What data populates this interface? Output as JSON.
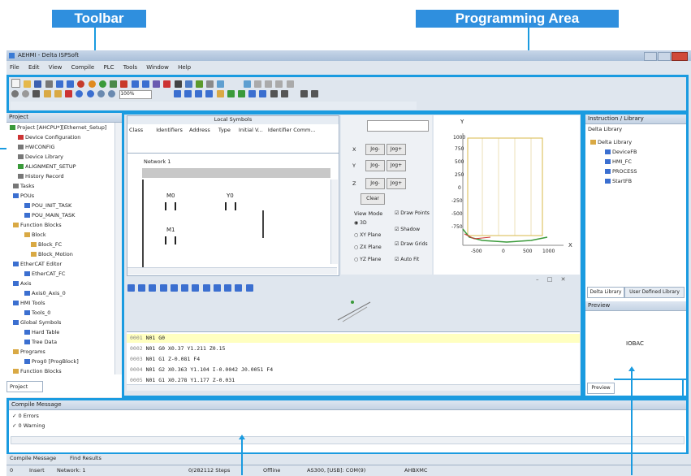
{
  "callouts": {
    "toolbar": "Toolbar",
    "programming_area": "Programming Area"
  },
  "window": {
    "title": "AEHMI - Delta ISPSoft",
    "menu": [
      "File",
      "Edit",
      "View",
      "Compile",
      "PLC",
      "Tools",
      "Window",
      "Help"
    ],
    "zoom": "100%"
  },
  "project_pane": {
    "title": "Project",
    "tab": "Project",
    "items": [
      "Project [AHCPU*][Ethernet_Setup]",
      "Device Configuration",
      "HWCONFIG",
      "Device Library",
      "ALIGNMENT_SETUP",
      "History Record",
      "Tasks",
      "POUs",
      "POU_INIT_TASK",
      "POU_MAIN_TASK",
      "Function Blocks",
      "Block",
      "Block_FC",
      "Block_Motion",
      "EtherCAT Editor",
      "EtherCAT_FC",
      "Axis",
      "Axis0_Axis_0",
      "HMI Tools",
      "Tools_0",
      "Global Symbols",
      "Hard Table",
      "Tree Data",
      "Programs",
      "Prog0 [ProgBlock]",
      "Function Blocks"
    ]
  },
  "local_symbols": {
    "title": "Local Symbols",
    "columns": [
      "Class",
      "Identifiers",
      "Address",
      "Type",
      "Initial V...",
      "Identifier Comm..."
    ]
  },
  "ladder": {
    "network": "Network 1",
    "contact1": "M0",
    "contact2": "M1",
    "coil": "Y0"
  },
  "motion_controls": {
    "dropdown": "",
    "rows": [
      {
        "axis": "X",
        "neg": "Jog-",
        "pos": "Jog+"
      },
      {
        "axis": "Y",
        "neg": "Jog-",
        "pos": "Jog+"
      },
      {
        "axis": "Z",
        "neg": "Jog-",
        "pos": "Jog+"
      }
    ],
    "clear": "Clear",
    "view_mode_label": "View Mode",
    "view_modes": [
      "3D",
      "XY Plane",
      "ZX Plane",
      "YZ Plane"
    ],
    "options": [
      "Draw Points",
      "Shadow",
      "Draw Grids",
      "Auto Fit"
    ]
  },
  "plot": {
    "y_axis_label": "Y",
    "x_axis_label": "X",
    "y_ticks": [
      "1000",
      "750",
      "500",
      "250",
      "0",
      "-250",
      "-500",
      "-750"
    ],
    "x_ticks": [
      "-500",
      "0",
      "500",
      "1000"
    ]
  },
  "gcode": {
    "lines": [
      {
        "num": "0001",
        "text": "N01 G0"
      },
      {
        "num": "0002",
        "text": "N01 G0 X0.37 Y1.211 Z0.15"
      },
      {
        "num": "0003",
        "text": "N01 G1 Z-0.081 F4"
      },
      {
        "num": "0004",
        "text": "N01 G2 X0.363 Y1.104 I-0.0042 J0.0051 F4"
      },
      {
        "num": "0005",
        "text": "N01 G1 X0.278 Y1.177 Z-0.031"
      }
    ]
  },
  "library": {
    "title": "Instruction / Library",
    "section": "Delta Library",
    "root": "Delta Library",
    "items": [
      "DeviceFB",
      "HMI_FC",
      "PROCESS",
      "StartFB"
    ],
    "tabs": [
      "Delta Library",
      "User Defined Library"
    ],
    "preview_title": "Preview",
    "preview_content": "IOBAC",
    "preview_tab": "Preview"
  },
  "compile": {
    "title": "Compile Message",
    "lines": [
      "0 Errors",
      "0 Warning"
    ],
    "tabs": [
      "Compile Message",
      "Find Results"
    ]
  },
  "status_bar": {
    "cells": [
      "0",
      "Insert",
      "Network: 1",
      "0/282112 Steps",
      "Offline",
      "AS300, [USB]: COM(9)",
      "AHBXMC"
    ]
  },
  "colors": {
    "callout_bg": "#2f8fde",
    "highlight": "#1a9be0",
    "gcode_highlight": "#ffffc0"
  }
}
